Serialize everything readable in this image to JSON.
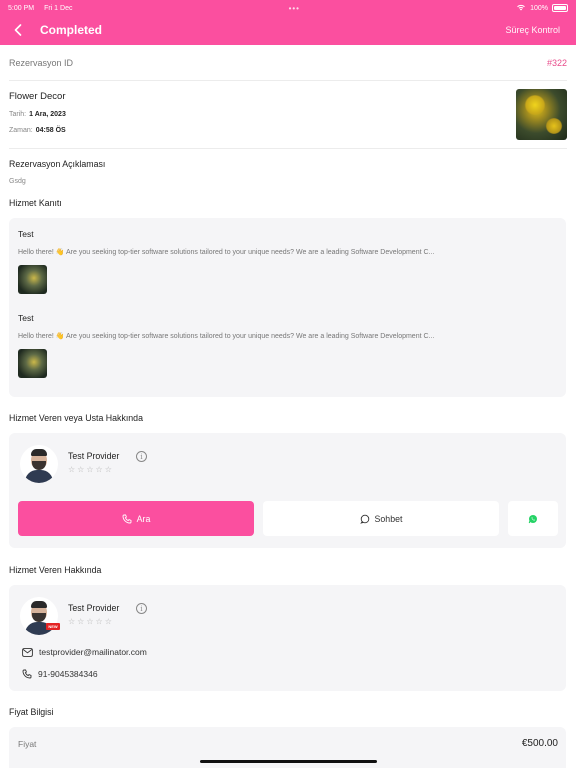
{
  "status_bar": {
    "time": "5:00 PM",
    "date": "Fri 1 Dec",
    "dots": "•••",
    "battery": "100%"
  },
  "header": {
    "title": "Completed",
    "action": "Süreç Kontrol"
  },
  "reservation": {
    "label": "Rezervasyon ID",
    "id": "#322"
  },
  "service": {
    "title": "Flower Decor",
    "date_label": "Tarih:",
    "date_value": "1 Ara, 2023",
    "time_label": "Zaman:",
    "time_value": "04:58 ÖS"
  },
  "description": {
    "title": "Rezervasyon Açıklaması",
    "text": "Gsdg"
  },
  "proof": {
    "title": "Hizmet Kanıtı",
    "items": [
      {
        "title": "Test",
        "text": "Hello there! 👋 Are you seeking top-tier software solutions tailored to your unique needs? We are a leading Software Development C..."
      },
      {
        "title": "Test",
        "text": "Hello there! 👋 Are you seeking top-tier software solutions tailored to your unique needs? We are a leading Software Development C..."
      }
    ]
  },
  "provider_section": {
    "title": "Hizmet Veren veya Usta Hakkında",
    "name": "Test Provider",
    "stars": "☆☆☆☆☆",
    "call_label": "Ara",
    "chat_label": "Sohbet"
  },
  "provider_about": {
    "title": "Hizmet Veren Hakkında",
    "name": "Test Provider",
    "badge": "NEW",
    "stars": "☆☆☆☆☆",
    "email": "testprovider@mailinator.com",
    "phone": "91-9045384346"
  },
  "price": {
    "title": "Fiyat Bilgisi",
    "label": "Fiyat",
    "value": "€500.00"
  },
  "colors": {
    "accent": "#fb4f9f",
    "id_color": "#e84c8b",
    "card_bg": "#f5f5f7"
  },
  "icons": [
    "back-chevron-icon",
    "info-icon",
    "phone-icon",
    "chat-icon",
    "whatsapp-icon",
    "mail-icon",
    "phone-icon"
  ]
}
